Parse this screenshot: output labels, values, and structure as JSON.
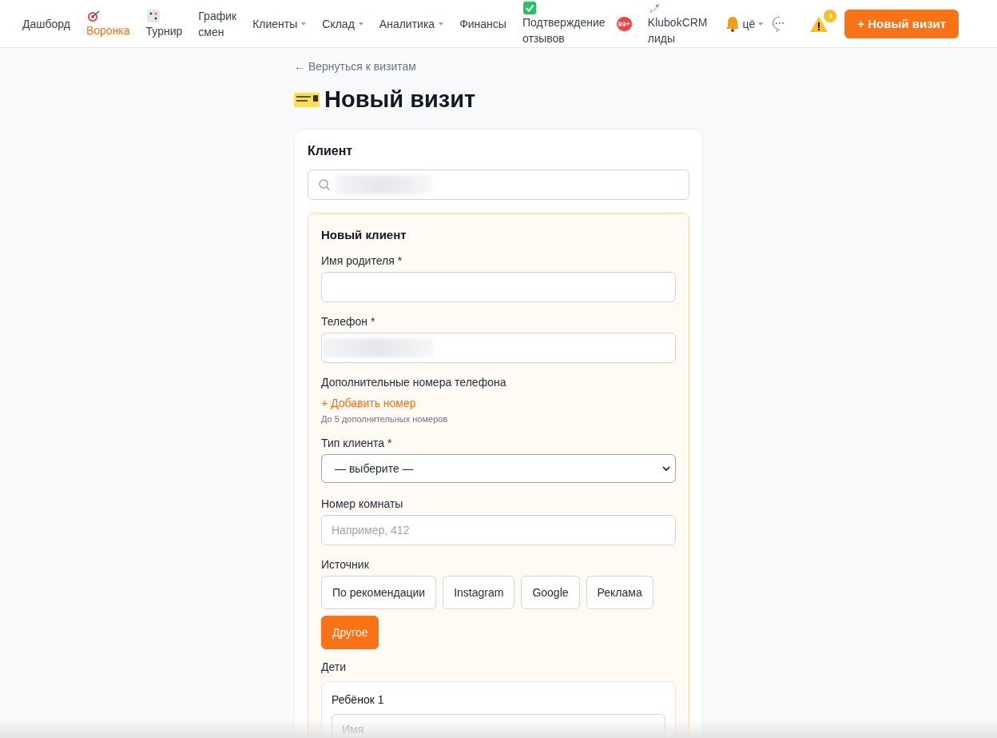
{
  "nav": {
    "items": [
      {
        "label": "Дашборд",
        "selected": false,
        "dropdown": false
      },
      {
        "label": "Воронка",
        "selected": true,
        "dropdown": false
      },
      {
        "label": "Турнир",
        "selected": false,
        "dropdown": false
      },
      {
        "label": "График\nсмен",
        "selected": false,
        "dropdown": false
      },
      {
        "label": "Клиенты",
        "selected": false,
        "dropdown": true
      },
      {
        "label": "Склад",
        "selected": false,
        "dropdown": true
      },
      {
        "label": "Аналитика",
        "selected": false,
        "dropdown": true
      },
      {
        "label": "Финансы",
        "selected": false,
        "dropdown": false
      },
      {
        "label": "Подтверждение\nотзывов",
        "selected": false,
        "dropdown": false
      },
      {
        "label": "KlubokCRM\nлиды",
        "selected": false,
        "dropdown": false,
        "badge_before": "99+"
      }
    ],
    "more": {
      "label": "цё"
    },
    "alerts_badge": "4",
    "new_visit_button": "+ Новый визит"
  },
  "back_link": "← Вернуться к визитам",
  "title": "Новый визит",
  "client_card": {
    "heading": "Клиент",
    "new_client": {
      "heading": "Новый клиент",
      "parent_name": {
        "label": "Имя родителя *"
      },
      "phone": {
        "label": "Телефон *"
      },
      "extra_phones": {
        "label": "Дополнительные номера телефона",
        "add_link": "+ Добавить номер",
        "hint": "До 5 дополнительных номеров"
      },
      "client_type": {
        "label": "Тип клиента *",
        "value": "— выберите —"
      },
      "room": {
        "label": "Номер комнаты",
        "placeholder": "Например, 412"
      },
      "source": {
        "label": "Источник",
        "options": [
          {
            "label": "По рекомендации",
            "selected": false
          },
          {
            "label": "Instagram",
            "selected": false
          },
          {
            "label": "Google",
            "selected": false
          },
          {
            "label": "Реклама",
            "selected": false
          },
          {
            "label": "Другое",
            "selected": true
          }
        ]
      },
      "children": {
        "label": "Дети",
        "items": [
          {
            "heading": "Ребёнок 1",
            "name_placeholder": "Имя"
          }
        ]
      }
    }
  }
}
